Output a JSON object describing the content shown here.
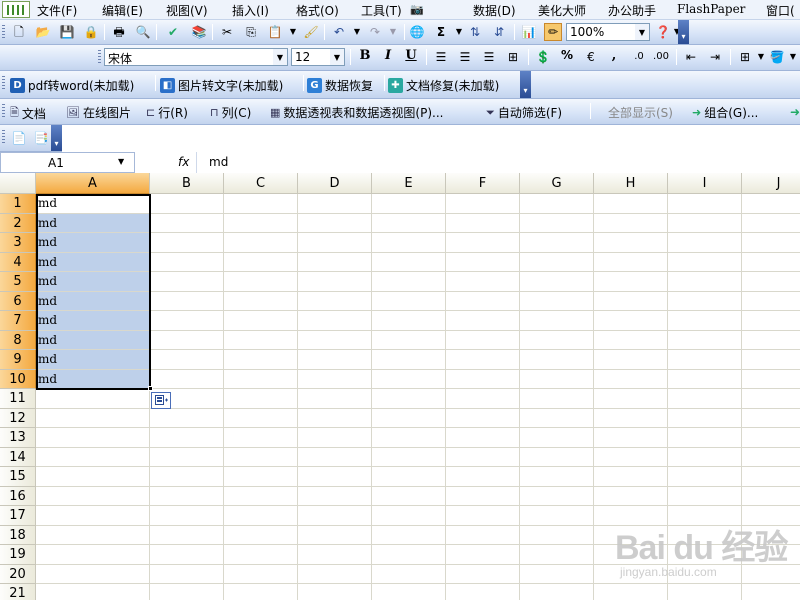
{
  "menubar": {
    "items": [
      "文件(F)",
      "编辑(E)",
      "视图(V)",
      "插入(I)",
      "格式(O)",
      "工具(T)",
      "数据(D)",
      "美化大师",
      "办公助手",
      "FlashPaper",
      "窗口("
    ]
  },
  "toolbar_standard": {
    "zoom": "100%"
  },
  "toolbar_formatting": {
    "font_name": "宋体",
    "font_size": "12",
    "bold_label": "B",
    "italic_label": "I",
    "underline_label": "U",
    "percent_label": "%",
    "comma_label": ","
  },
  "toolbar_plugins": {
    "items": [
      {
        "label": "pdf转word(未加载)",
        "icon": "D",
        "color": "#1f5fb4"
      },
      {
        "label": "图片转文字(未加载)",
        "icon": "◧",
        "color": "#2a6fc9"
      },
      {
        "label": "数据恢复",
        "icon": "G",
        "color": "#2e7fd6"
      },
      {
        "label": "文档修复(未加载)",
        "icon": "✚",
        "color": "#2aa8a0"
      }
    ]
  },
  "toolbar_pivot": {
    "items": [
      "文档",
      "在线图片",
      "行(R)",
      "列(C)",
      "数据透视表和数据透视图(P)...",
      "自动筛选(F)",
      "全部显示(S)",
      "组合(G)..."
    ]
  },
  "formula_bar": {
    "name_box": "A1",
    "fx": "fx",
    "content": "md"
  },
  "sheet": {
    "columns": [
      "A",
      "B",
      "C",
      "D",
      "E",
      "F",
      "G",
      "H",
      "I",
      "J"
    ],
    "rows": [
      "1",
      "2",
      "3",
      "4",
      "5",
      "6",
      "7",
      "8",
      "9",
      "10",
      "11",
      "12",
      "13",
      "14",
      "15",
      "16",
      "17",
      "18",
      "19",
      "20",
      "21"
    ],
    "column_a_values": [
      "md",
      "md",
      "md",
      "md",
      "md",
      "md",
      "md",
      "md",
      "md",
      "md"
    ]
  },
  "watermark": {
    "logo": "Bai du 经验",
    "url": "jingyan.baidu.com"
  },
  "colors": {
    "selection": "#bed0ea",
    "header_selected": "#f4a940",
    "toolbar": "#d6e3f7"
  }
}
